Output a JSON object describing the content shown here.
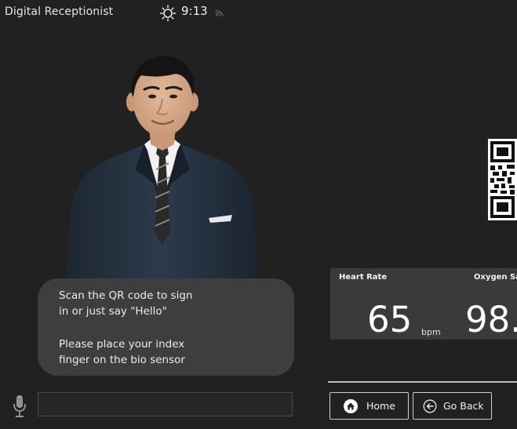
{
  "status_bar": {
    "app_title": "Digital Receptionist",
    "weather_icon": "sun-icon",
    "time": "9:13",
    "connection_icon": "wifi-icon"
  },
  "receptionist": {
    "avatar": "receptionist-avatar",
    "messages": {
      "line1": "Scan the QR code to sign",
      "line2": "in or just say \"Hello\"",
      "line3": "Please place your index",
      "line4": "finger on the bio sensor"
    }
  },
  "voice_input": {
    "mic_icon": "microphone-icon",
    "value": "",
    "placeholder": ""
  },
  "qr": {
    "icon": "qr-code-icon"
  },
  "vitals": {
    "heart_rate": {
      "label": "Heart Rate",
      "value": "65",
      "unit": "bpm"
    },
    "oxygen": {
      "label": "Oxygen Sat",
      "value": "98."
    }
  },
  "nav": {
    "home_label": "Home",
    "home_icon": "home-icon",
    "back_label": "Go Back",
    "back_icon": "back-arrow-icon"
  },
  "colors": {
    "background": "#212121",
    "bubble": "#3e3e3e",
    "panel": "#3a3a3a",
    "text": "#e8e8e8"
  }
}
